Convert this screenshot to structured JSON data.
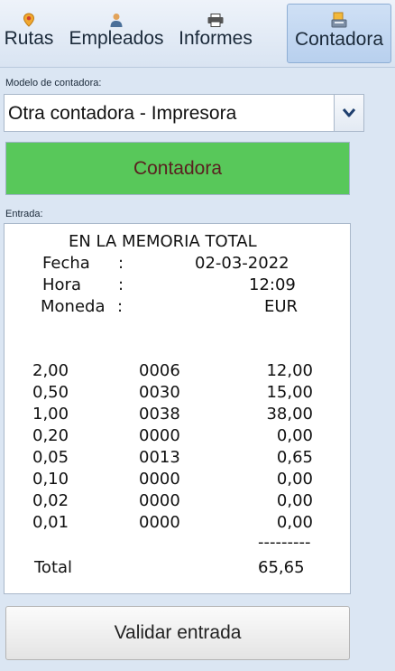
{
  "tabs": [
    {
      "label": "Rutas",
      "icon": "map-pin-icon",
      "active": false
    },
    {
      "label": "Empleados",
      "icon": "person-icon",
      "active": false
    },
    {
      "label": "Informes",
      "icon": "printer-icon",
      "active": false
    },
    {
      "label": "Contadora",
      "icon": "counter-icon",
      "active": true
    }
  ],
  "modelo": {
    "label": "Modelo de contadora:",
    "selected": "Otra contadora - Impresora"
  },
  "contadora_button": {
    "label": "Contadora",
    "color": "#58c85a"
  },
  "entrada": {
    "label": "Entrada:",
    "header": {
      "title": "EN LA MEMORIA TOTAL",
      "fecha_label": "Fecha",
      "fecha_value": "02-03-2022",
      "hora_label": "Hora",
      "hora_value": "12:09",
      "moneda_label": "Moneda",
      "moneda_value": "EUR",
      "sep": ":"
    },
    "rows": [
      {
        "denom": "2,00",
        "count": "0006",
        "amount": "12,00"
      },
      {
        "denom": "0,50",
        "count": "0030",
        "amount": "15,00"
      },
      {
        "denom": "1,00",
        "count": "0038",
        "amount": "38,00"
      },
      {
        "denom": "0,20",
        "count": "0000",
        "amount": "0,00"
      },
      {
        "denom": "0,05",
        "count": "0013",
        "amount": "0,65"
      },
      {
        "denom": "0,10",
        "count": "0000",
        "amount": "0,00"
      },
      {
        "denom": "0,02",
        "count": "0000",
        "amount": "0,00"
      },
      {
        "denom": "0,01",
        "count": "0000",
        "amount": "0,00"
      }
    ],
    "divider": "---------",
    "total_label": "Total",
    "total_value": "65,65"
  },
  "validate_button": {
    "label": "Validar entrada"
  }
}
